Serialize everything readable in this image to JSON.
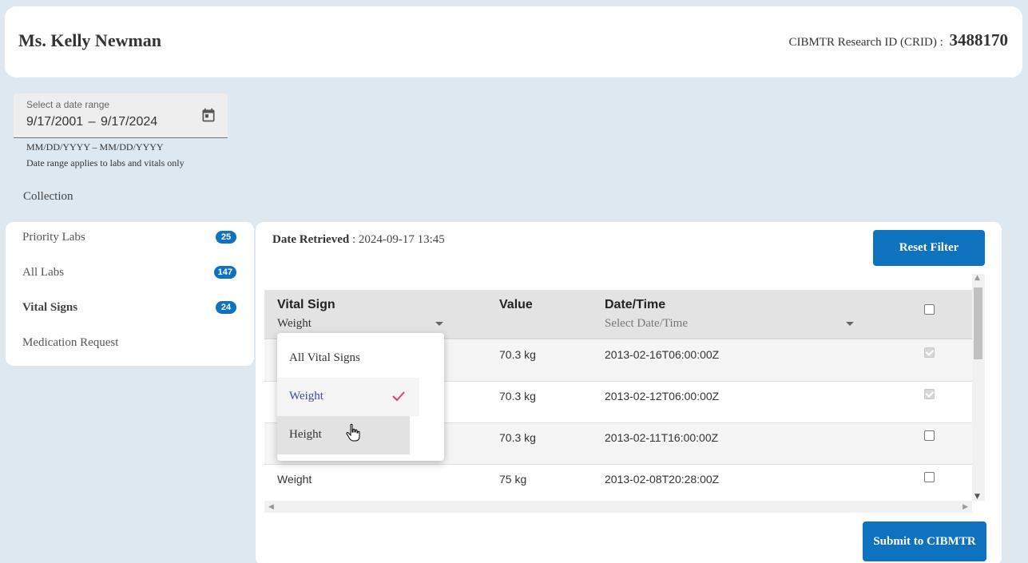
{
  "header": {
    "patient_name": "Ms. Kelly Newman",
    "crid_label": "CIBMTR Research ID (CRID) :",
    "crid_value": "3488170"
  },
  "date_range": {
    "label": "Select a date range",
    "value": "9/17/2001 – 9/17/2024",
    "format_hint": "MM/DD/YYYY – MM/DD/YYYY",
    "note": "Date range applies to labs and vitals only"
  },
  "collection_label": "Collection",
  "sidebar": {
    "items": [
      {
        "label": "Priority Labs",
        "count": "25"
      },
      {
        "label": "All Labs",
        "count": "147"
      },
      {
        "label": "Vital Signs",
        "count": "24"
      },
      {
        "label": "Medication Request"
      }
    ]
  },
  "main": {
    "retrieved_label": "Date Retrieved",
    "retrieved_value": ": 2024-09-17 13:45",
    "reset_label": "Reset Filter",
    "submit_label": "Submit to CIBMTR"
  },
  "table": {
    "headers": {
      "vital_sign": "Vital Sign",
      "value": "Value",
      "datetime": "Date/Time"
    },
    "filters": {
      "vital_sign": "Weight",
      "datetime_placeholder": "Select Date/Time"
    },
    "rows": [
      {
        "vital": "",
        "value": "70.3 kg",
        "datetime": "2013-02-16T06:00:00Z",
        "checked": true,
        "disabled": true
      },
      {
        "vital": "",
        "value": "70.3 kg",
        "datetime": "2013-02-12T06:00:00Z",
        "checked": true,
        "disabled": true
      },
      {
        "vital": "",
        "value": "70.3 kg",
        "datetime": "2013-02-11T16:00:00Z",
        "checked": false,
        "disabled": false
      },
      {
        "vital": "Weight",
        "value": "75 kg",
        "datetime": "2013-02-08T20:28:00Z",
        "checked": false,
        "disabled": false
      }
    ]
  },
  "dropdown": {
    "options": [
      {
        "label": "All Vital Signs"
      },
      {
        "label": "Weight",
        "selected": true
      },
      {
        "label": "Height",
        "hover": true
      }
    ]
  },
  "colors": {
    "accent": "#0f72bf",
    "check": "#e0407a",
    "selected_text": "#3a4aa0"
  }
}
